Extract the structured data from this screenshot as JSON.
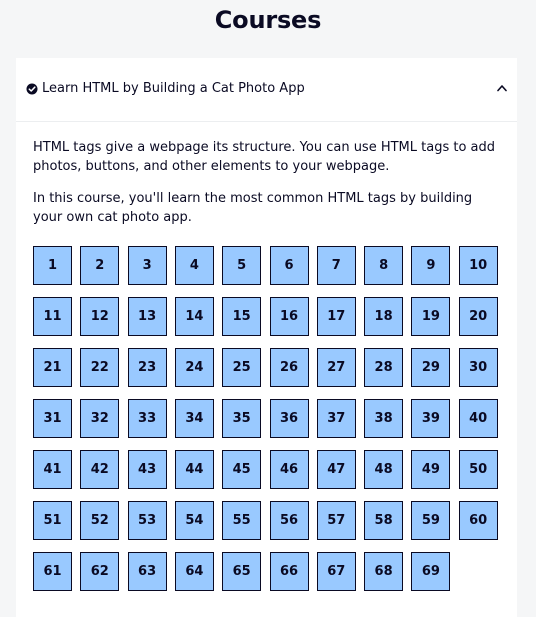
{
  "page": {
    "title": "Courses"
  },
  "block": {
    "title": "Learn HTML by Building a Cat Photo App",
    "status_icon": "check-circle-icon",
    "toggle_icon": "caret-up-icon",
    "description": [
      "HTML tags give a webpage its structure. You can use HTML tags to add photos, buttons, and other elements to your webpage.",
      "In this course, you'll learn the most common HTML tags by building your own cat photo app."
    ],
    "steps": [
      "1",
      "2",
      "3",
      "4",
      "5",
      "6",
      "7",
      "8",
      "9",
      "10",
      "11",
      "12",
      "13",
      "14",
      "15",
      "16",
      "17",
      "18",
      "19",
      "20",
      "21",
      "22",
      "23",
      "24",
      "25",
      "26",
      "27",
      "28",
      "29",
      "30",
      "31",
      "32",
      "33",
      "34",
      "35",
      "36",
      "37",
      "38",
      "39",
      "40",
      "41",
      "42",
      "43",
      "44",
      "45",
      "46",
      "47",
      "48",
      "49",
      "50",
      "51",
      "52",
      "53",
      "54",
      "55",
      "56",
      "57",
      "58",
      "59",
      "60",
      "61",
      "62",
      "63",
      "64",
      "65",
      "66",
      "67",
      "68",
      "69"
    ]
  },
  "colors": {
    "background": "#f5f6f7",
    "panel": "#ffffff",
    "step_fill": "#99c9ff",
    "text": "#0a0a23"
  }
}
